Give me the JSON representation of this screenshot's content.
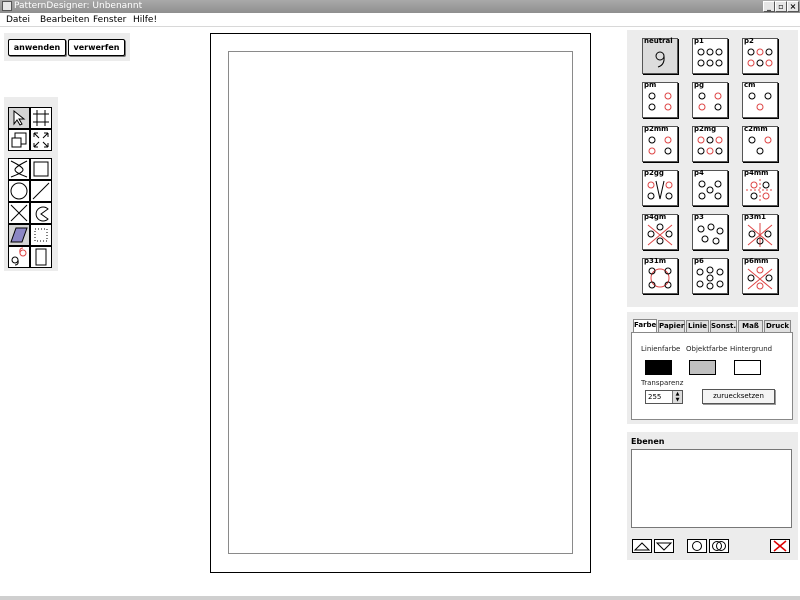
{
  "window": {
    "title": "PatternDesigner: Unbenannt"
  },
  "menu": [
    "Datei",
    "Bearbeiten",
    "Fenster",
    "Hilfe!"
  ],
  "actions": {
    "apply_label": "anwenden",
    "discard_label": "verwerfen"
  },
  "tools": [
    "select-arrow-icon",
    "transform-icon",
    "move-object-icon",
    "scale-icon",
    "curve-icon",
    "rectangle-icon",
    "circle-icon",
    "line-icon",
    "crossed-square-icon",
    "arc-icon",
    "parallelogram-icon",
    "dotted-square-icon",
    "motif-icon",
    "page-icon"
  ],
  "symmetry_groups": [
    "neutral",
    "p1",
    "p2",
    "pm",
    "pg",
    "cm",
    "p2mm",
    "p2mg",
    "c2mm",
    "p2gg",
    "p4",
    "p4mm",
    "p4gm",
    "p3",
    "p3m1",
    "p31m",
    "p6",
    "p6mm"
  ],
  "properties": {
    "tabs": [
      "Farbe",
      "Papier",
      "Linie",
      "Sonst.",
      "Maß",
      "Druck"
    ],
    "active_tab": "Farbe",
    "line_color_label": "Linienfarbe",
    "object_color_label": "Objektfarbe",
    "background_label": "Hintergrund",
    "line_color": "#000000",
    "object_color": "#c0c0c0",
    "background_color": "#ffffff",
    "transparency_label": "Transparenz",
    "transparency_value": "255",
    "reset_label": "zuruecksetzen"
  },
  "layers": {
    "title": "Ebenen"
  }
}
